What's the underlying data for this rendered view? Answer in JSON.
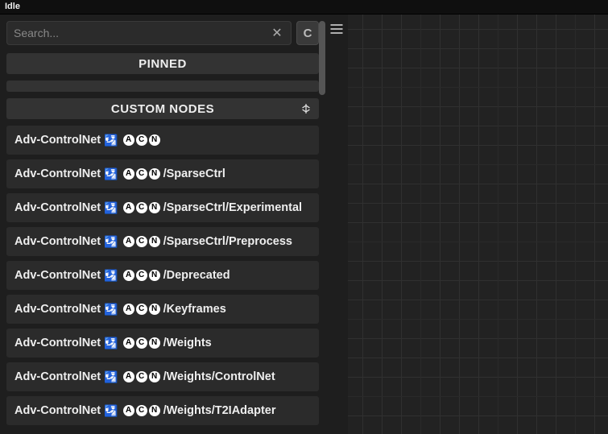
{
  "titlebar": {
    "status": "Idle"
  },
  "search": {
    "placeholder": "Search...",
    "value": ""
  },
  "collapse_letter": "C",
  "sections": {
    "pinned": "PINNED",
    "custom": "CUSTOM NODES"
  },
  "node_prefix": "Adv-ControlNet",
  "node_badge_emoji": "🛂",
  "node_badge_letters": [
    "A",
    "C",
    "N"
  ],
  "nodes": [
    {
      "suffix": ""
    },
    {
      "suffix": "/SparseCtrl"
    },
    {
      "suffix": "/SparseCtrl/Experimental"
    },
    {
      "suffix": "/SparseCtrl/Preprocess"
    },
    {
      "suffix": "/Deprecated"
    },
    {
      "suffix": "/Keyframes"
    },
    {
      "suffix": "/Weights"
    },
    {
      "suffix": "/Weights/ControlNet"
    },
    {
      "suffix": "/Weights/T2IAdapter"
    }
  ]
}
